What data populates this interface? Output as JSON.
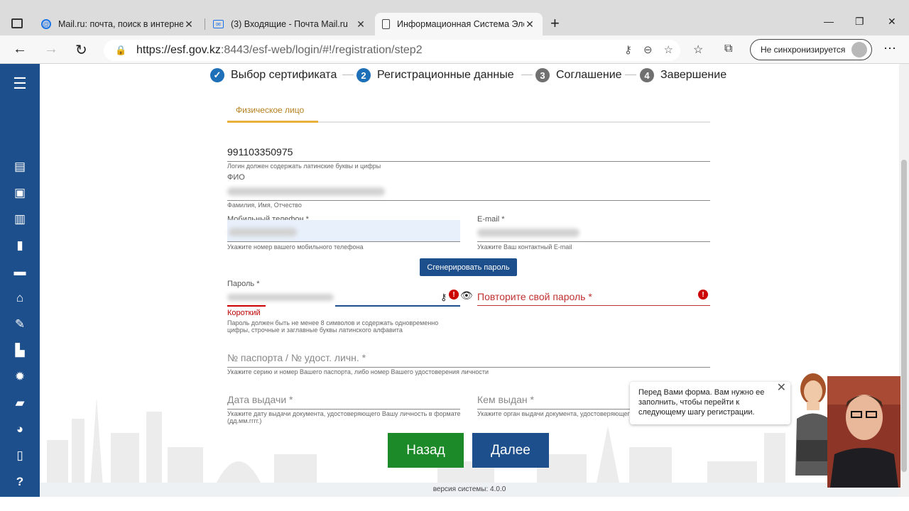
{
  "browser": {
    "tabs": [
      {
        "title": "Mail.ru: почта, поиск в интерне",
        "icon": "mailru-icon"
      },
      {
        "title": "(3) Входящие - Почта Mail.ru",
        "icon": "mail-envelope-icon"
      },
      {
        "title": "Информационная Система Эле",
        "icon": "document-icon"
      }
    ],
    "url_host": "https://esf.gov.kz",
    "url_rest": ":8443/esf-web/login/#!/registration/step2",
    "sync_label": "Не синхронизируется"
  },
  "stepper": [
    {
      "num": "✓",
      "label": "Выбор сертификата",
      "state": "done",
      "color": "#1d6fb8"
    },
    {
      "num": "2",
      "label": "Регистрационные данные",
      "state": "active",
      "color": "#1d6fb8"
    },
    {
      "num": "3",
      "label": "Соглашение",
      "state": "pending",
      "color": "#707070"
    },
    {
      "num": "4",
      "label": "Завершение",
      "state": "pending",
      "color": "#707070"
    }
  ],
  "form": {
    "tab_label": "Физическое лицо",
    "login": {
      "value": "991103350975",
      "hint": "Логин должен содержать латинские буквы и цифры"
    },
    "fio": {
      "label": "ФИО",
      "hint": "Фамилия, Имя, Отчество"
    },
    "phone": {
      "label": "Мобильный телефон *",
      "hint": "Укажите номер вашего мобильного телефона"
    },
    "email": {
      "label": "E-mail *",
      "hint": "Укажите Ваш контактный E-mail"
    },
    "generate_button": "Сгенерировать пароль",
    "password": {
      "label": "Пароль *",
      "strength": "Короткий",
      "hint": "Пароль должен быть не менее 8 символов и содержать одновременно цифры, строчные и заглавные буквы латинского алфавита"
    },
    "password_repeat": {
      "placeholder": "Повторите свой пароль *"
    },
    "passport": {
      "placeholder": "№ паспорта / № удост. личн. *",
      "hint": "Укажите серию и номер Вашего паспорта, либо номер Вашего удостоверения личности"
    },
    "issue_date": {
      "placeholder": "Дата выдачи *",
      "hint": "Укажите дату выдачи документа, удостоверяющего Вашу личность в формате (дд.мм.гггг.)"
    },
    "issued_by": {
      "placeholder": "Кем выдан *",
      "hint": "Укажите орган выдачи документа, удостоверяющего"
    },
    "back_button": "Назад",
    "next_button": "Далее"
  },
  "assistant": {
    "message": "Перед Вами форма. Вам нужно ее заполнить, чтобы перейти к следующему шагу регистрации."
  },
  "footer": {
    "version": "версия системы: 4.0.0"
  },
  "sidebar": {
    "icons": [
      "menu-icon",
      "document-icon",
      "id-card-icon",
      "building-icon",
      "file-icon",
      "briefcase-icon",
      "warehouse-icon",
      "edit-document-icon",
      "cart-icon",
      "gear-icon",
      "folder-open-icon",
      "dashboard-icon",
      "book-icon",
      "help-icon"
    ]
  },
  "colors": {
    "sidebar": "#1d4f8c",
    "primary": "#1d4f8c",
    "success": "#1c8a28",
    "error": "#c00000",
    "tab_accent": "#e8b23a"
  }
}
